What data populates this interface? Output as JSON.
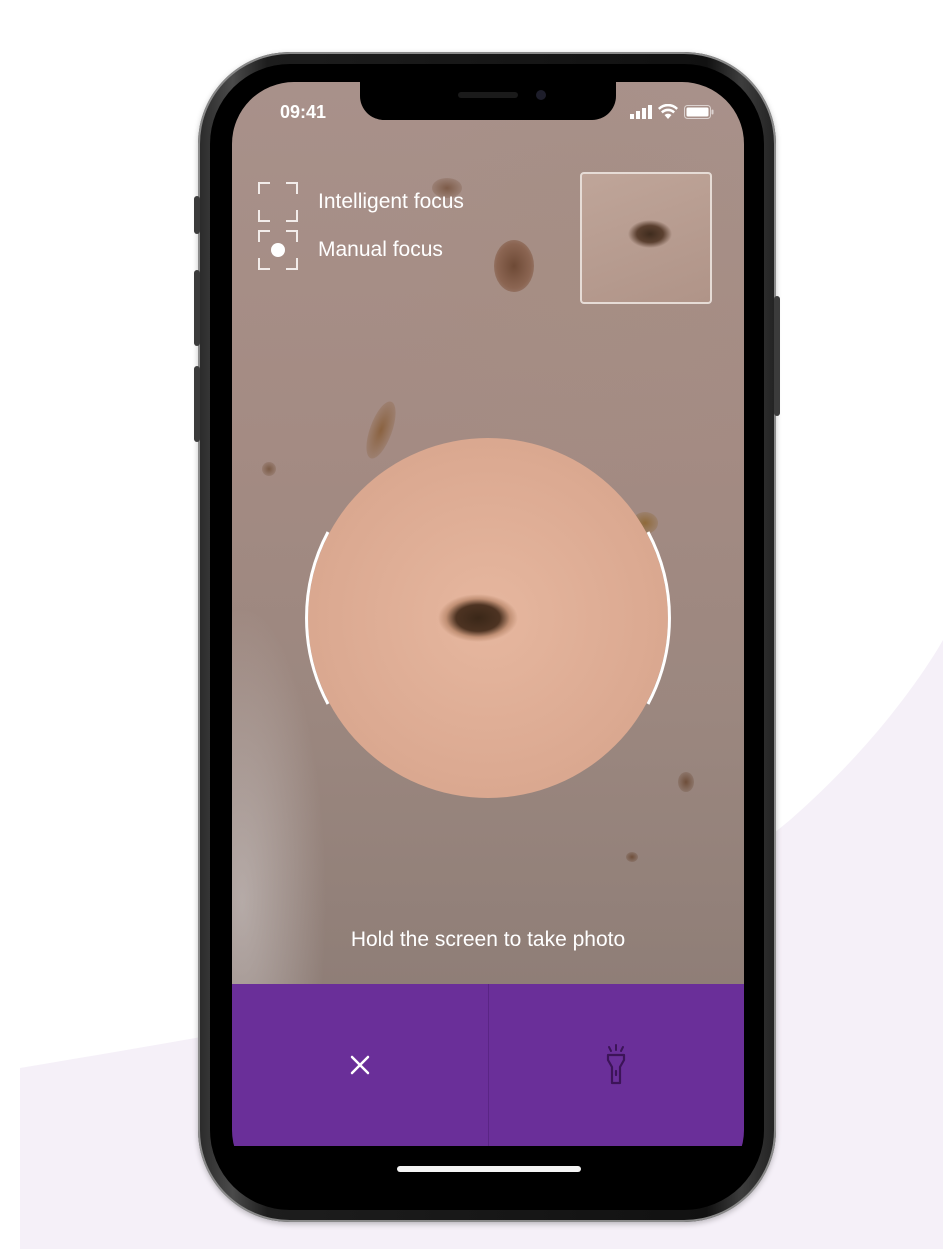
{
  "status_bar": {
    "time": "09:41"
  },
  "focus_options": [
    {
      "label": "Intelligent focus",
      "icon": "intelligent-focus-icon",
      "selected": false
    },
    {
      "label": "Manual focus",
      "icon": "manual-focus-icon",
      "selected": true
    }
  ],
  "hint": "Hold the screen to take photo",
  "actions": {
    "close_icon": "×",
    "flashlight_icon": "flashlight-icon"
  },
  "colors": {
    "action_bar": "#6a2f99",
    "accent_icon": "#3c1458"
  }
}
